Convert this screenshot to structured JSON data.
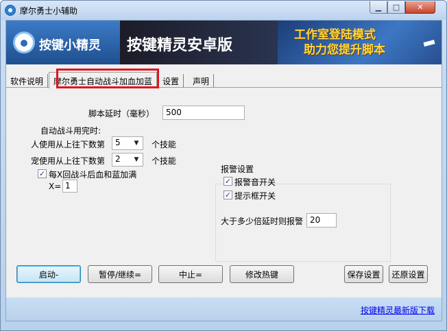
{
  "window": {
    "title": "摩尔勇士小辅助",
    "minimize_glyph": "▁",
    "maximize_glyph": "□",
    "close_glyph": "✕"
  },
  "banner": {
    "logo_text": "按键小精灵",
    "product_title": "按键精灵安卓版",
    "slogan_line1": "工作室登陆模式",
    "slogan_line2": "助力您提升脚本"
  },
  "tabs": [
    {
      "label": "软件说明"
    },
    {
      "label": "摩尔勇士自动战斗加血加蓝"
    },
    {
      "label": "设置"
    },
    {
      "label": "声明"
    }
  ],
  "form": {
    "script_delay_label": "脚本延时（毫秒）",
    "script_delay_value": "500",
    "auto_battle_label": "自动战斗用完时:",
    "person_label": "人使用从上往下数第",
    "person_value": "5",
    "person_suffix": "个技能",
    "pet_label": "宠使用从上往下数第",
    "pet_value": "2",
    "pet_suffix": "个技能",
    "every_x_label": "每X回战斗后血和蓝加满",
    "every_x_checked": "✓",
    "x_label": "X=",
    "x_value": "1"
  },
  "alarm": {
    "group_title": "报警设置",
    "sound_label": "报警音开关",
    "sound_checked": "✓",
    "prompt_label": "提示框开关",
    "prompt_checked": "✓",
    "multiple_label": "大于多少倍延时则报警",
    "multiple_value": "20"
  },
  "buttons": {
    "start": "启动-",
    "pause": "暂停/继续=",
    "stop": "中止=",
    "hotkey": "修改热键",
    "save": "保存设置",
    "restore": "还原设置"
  },
  "status": {
    "download_link": "按键精灵最新版下载"
  }
}
